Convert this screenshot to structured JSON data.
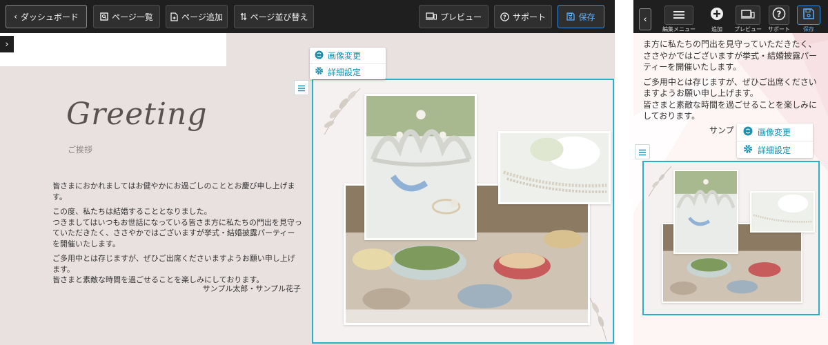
{
  "toolbar": {
    "dashboard": "ダッシュボード",
    "page_list": "ページ一覧",
    "add_page": "ページ追加",
    "reorder": "ページ並び替え",
    "preview": "プレビュー",
    "support": "サポート",
    "save": "保存"
  },
  "greeting": {
    "title": "Greeting",
    "subtitle": "ご挨拶",
    "paragraphs": [
      "皆さまにおかれましてはお健やかにお過ごしのこととお慶び申し上げます。",
      "この度、私たちは結婚することとなりました。\nつきましてはいつもお世話になっている皆さま方に私たちの門出を見守っていただきたく、ささやかではございますが挙式・結婚披露パーティーを開催いたします。",
      "ご多用中とは存じますが、ぜひご出席くださいますようお願い申し上げます。\n皆さまと素敵な時間を過ごせることを楽しみにしております。"
    ],
    "signature": "サンプル太郎・サンプル花子"
  },
  "image_menu": {
    "change_image": "画像変更",
    "detail_settings": "詳細設定"
  },
  "mobile": {
    "toolbar": {
      "edit_menu": "編集メニュー",
      "add": "追加",
      "preview": "プレビュー",
      "support": "サポート",
      "save": "保存"
    },
    "paragraphs": [
      "ま方に私たちの門出を見守っていただきたく、ささやかではございますが挙式・結婚披露パーティーを開催いたします。",
      "ご多用中とは存じますが、ぜひご出席くださいますようお願い申し上げます。\n皆さまと素敵な時間を過ごせることを楽しみにしております。"
    ],
    "signature_partial": "サンプ",
    "image_menu": {
      "change_image": "画像変更",
      "detail_settings": "詳細設定"
    }
  },
  "colors": {
    "toolbar_bg": "#1f1f1f",
    "accent": "#26b1c4",
    "save_blue": "#3d8fe0",
    "page_bg": "#e9e1e0"
  }
}
